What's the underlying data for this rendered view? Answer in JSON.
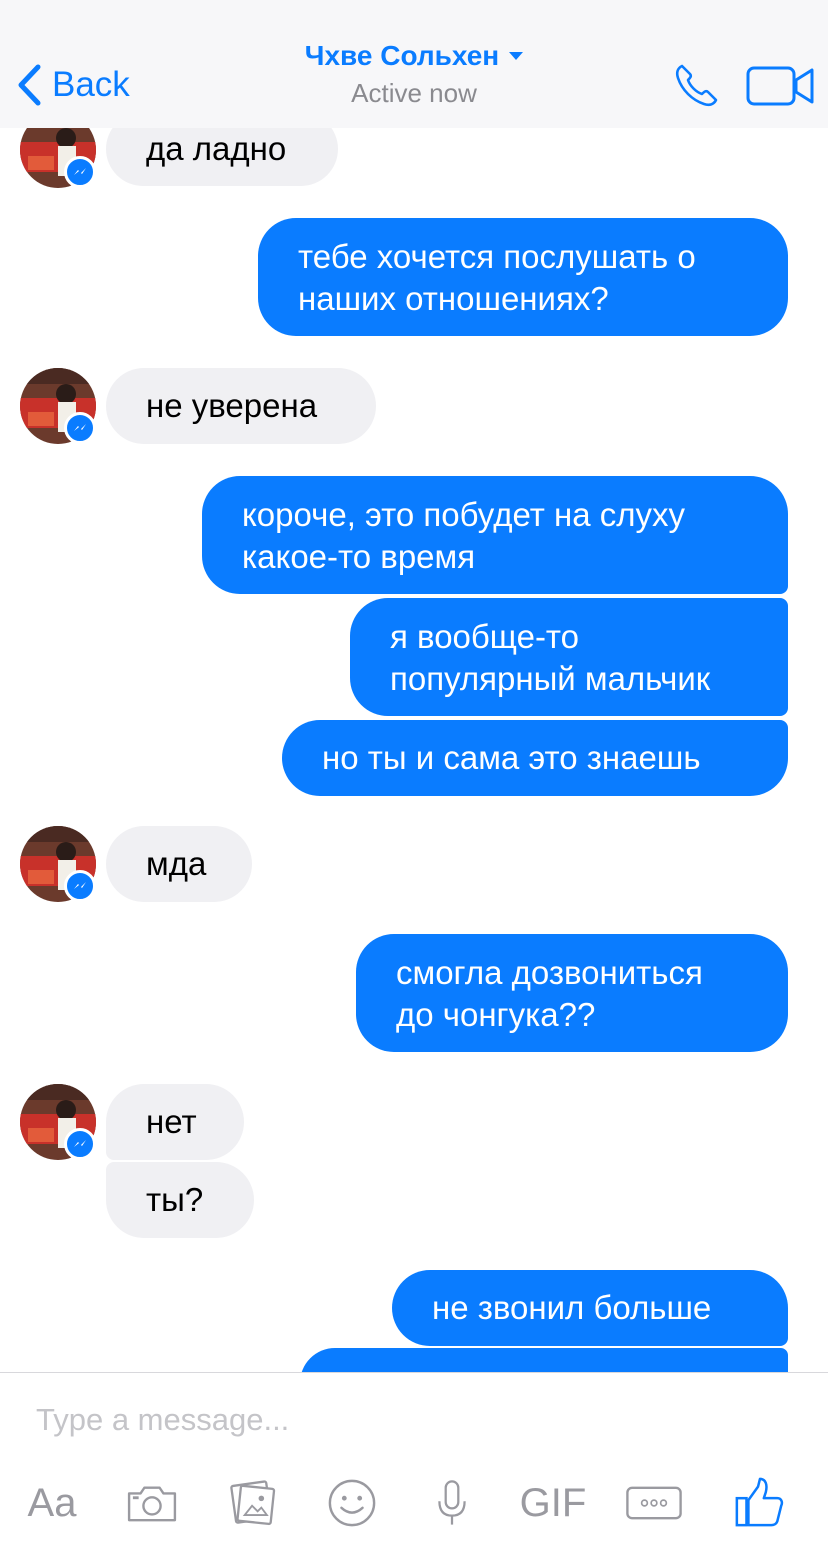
{
  "header": {
    "back_label": "Back",
    "contact_name": "Чхве Сольхен",
    "status": "Active now"
  },
  "messages": [
    {
      "side": "in",
      "text": "да ладно"
    },
    {
      "side": "out",
      "text": "тебе хочется послушать о наших отношениях?"
    },
    {
      "side": "in",
      "text": "не уверена"
    },
    {
      "side": "out",
      "text": "короче, это побудет на слуху какое-то время"
    },
    {
      "side": "out",
      "text": "я вообще-то популярный мальчик"
    },
    {
      "side": "out",
      "text": "но ты и сама это знаешь"
    },
    {
      "side": "in",
      "text": "мда"
    },
    {
      "side": "out",
      "text": "смогла дозвониться до чонгука??"
    },
    {
      "side": "in",
      "text": "нет"
    },
    {
      "side": "in",
      "text": "ты?"
    },
    {
      "side": "out",
      "text": "не звонил больше"
    }
  ],
  "composer": {
    "placeholder": "Type a message...",
    "text_button": "Aa",
    "gif_button": "GIF"
  },
  "colors": {
    "accent": "#0a7cff",
    "incoming_bubble": "#f0f0f3",
    "header_bg": "#f7f7f9"
  },
  "icons": [
    "chevron-left-icon",
    "phone-icon",
    "video-camera-icon",
    "messenger-badge-icon",
    "camera-icon",
    "photo-icon",
    "smiley-icon",
    "microphone-icon",
    "more-icon",
    "thumbs-up-icon"
  ]
}
